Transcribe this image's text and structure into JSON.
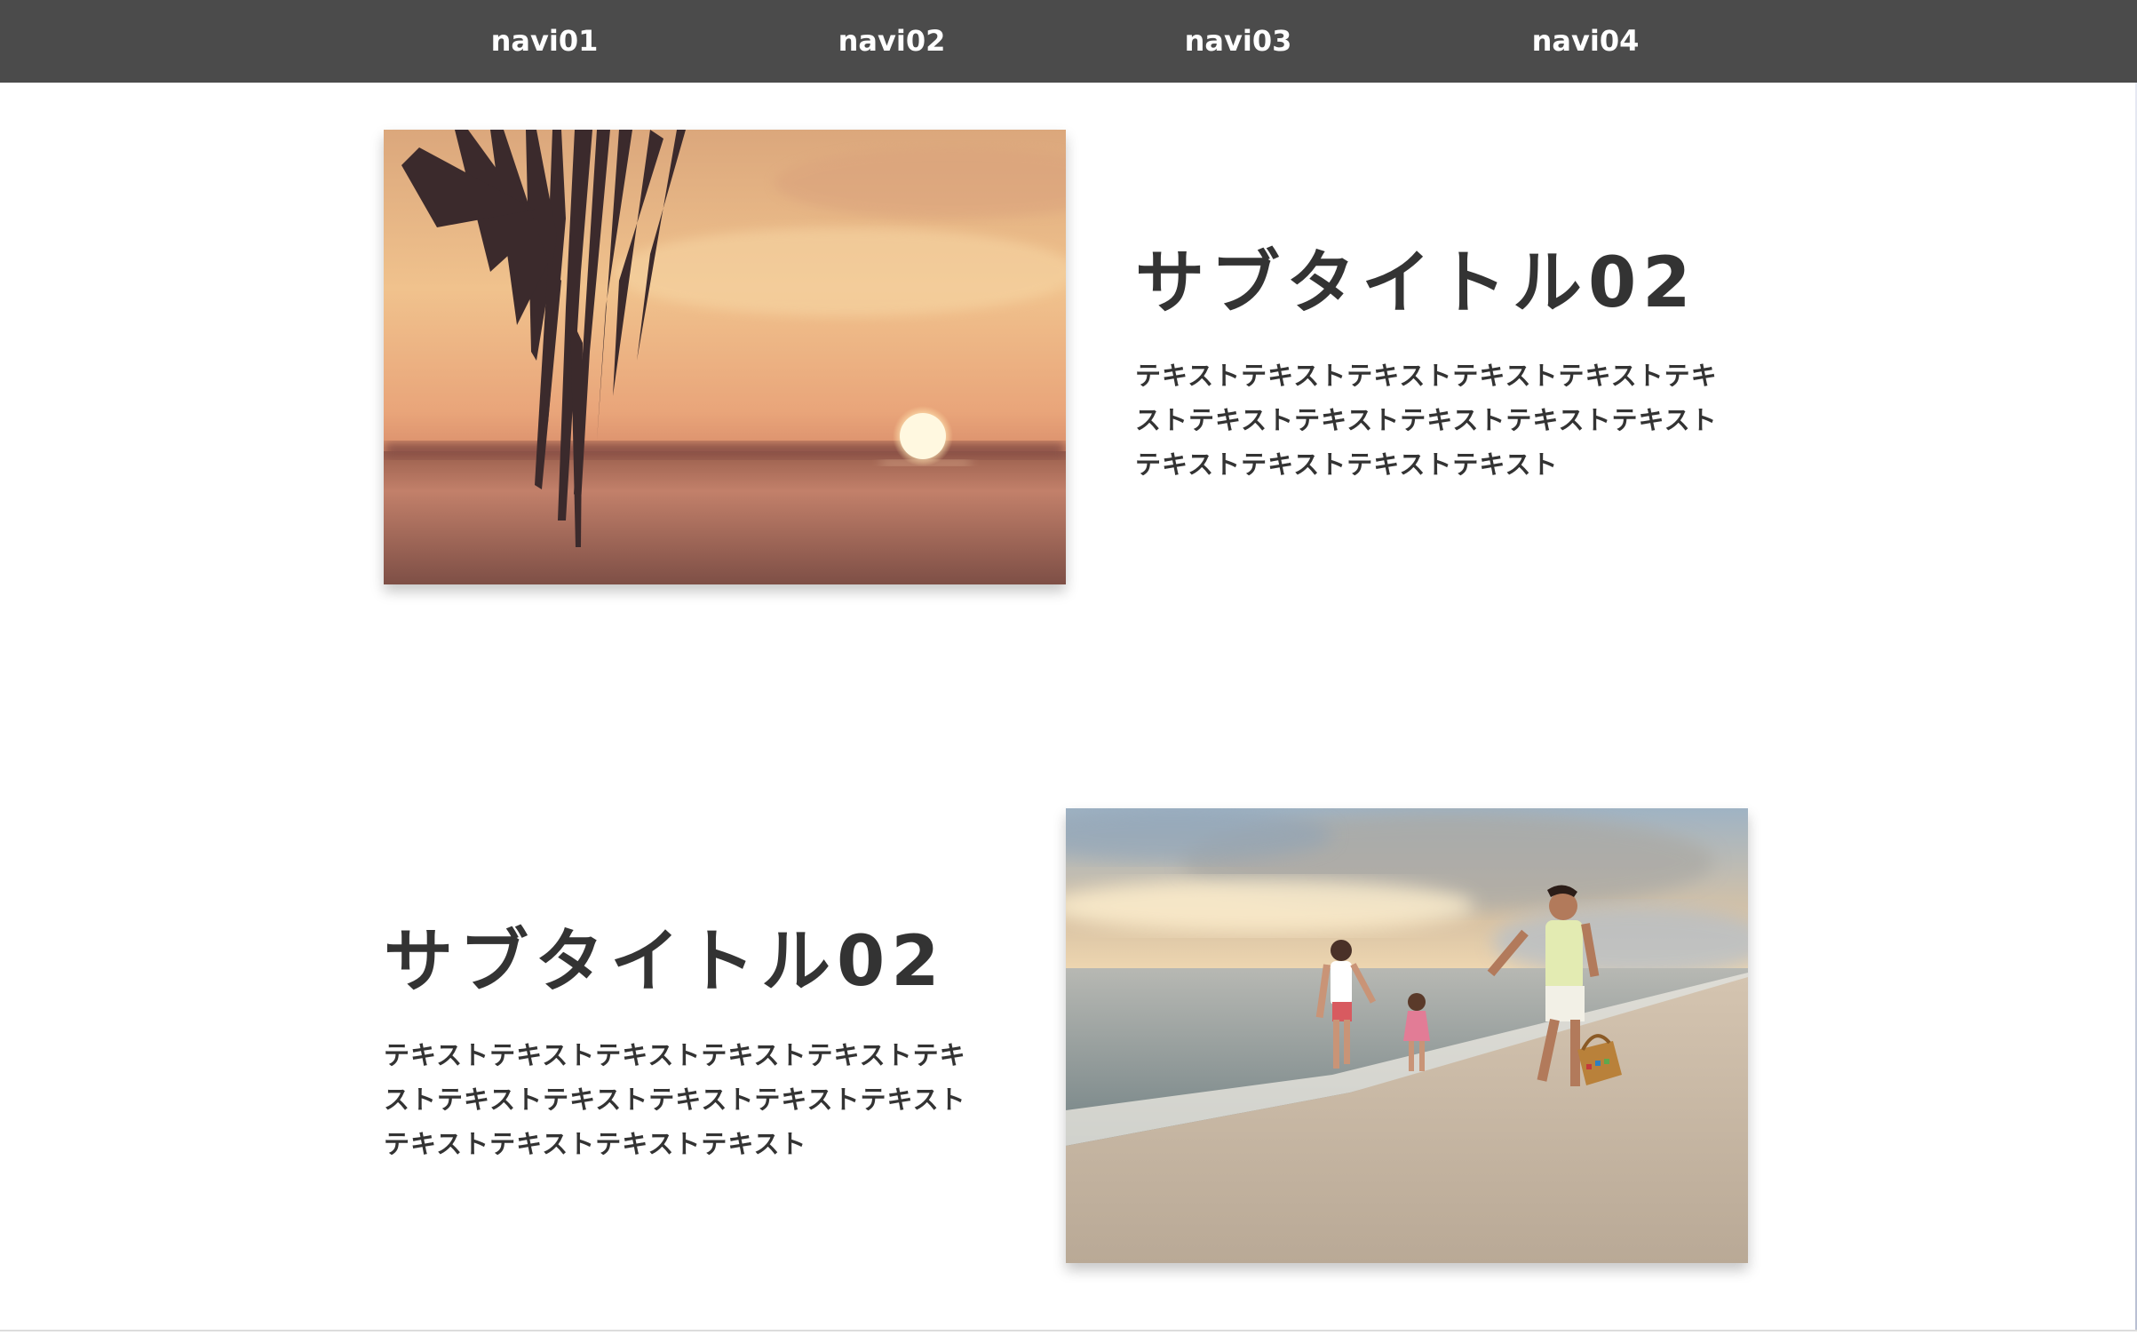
{
  "nav": {
    "items": [
      {
        "label": "navi01"
      },
      {
        "label": "navi02"
      },
      {
        "label": "navi03"
      },
      {
        "label": "navi04"
      }
    ]
  },
  "sections": [
    {
      "subtitle": "サブタイトル02",
      "text": "テキストテキストテキストテキストテキストテキストテキストテキストテキストテキストテキストテキストテキストテキストテキスト",
      "image": "sunset-palm-photo"
    },
    {
      "subtitle": "サブタイトル02",
      "text": "テキストテキストテキストテキストテキストテキストテキストテキストテキストテキストテキストテキストテキストテキストテキスト",
      "image": "family-beach-photo"
    }
  ],
  "colors": {
    "nav_background": "#4b4b4b",
    "nav_text": "#ffffff",
    "heading_text": "#333333",
    "page_background": "#ffffff"
  }
}
